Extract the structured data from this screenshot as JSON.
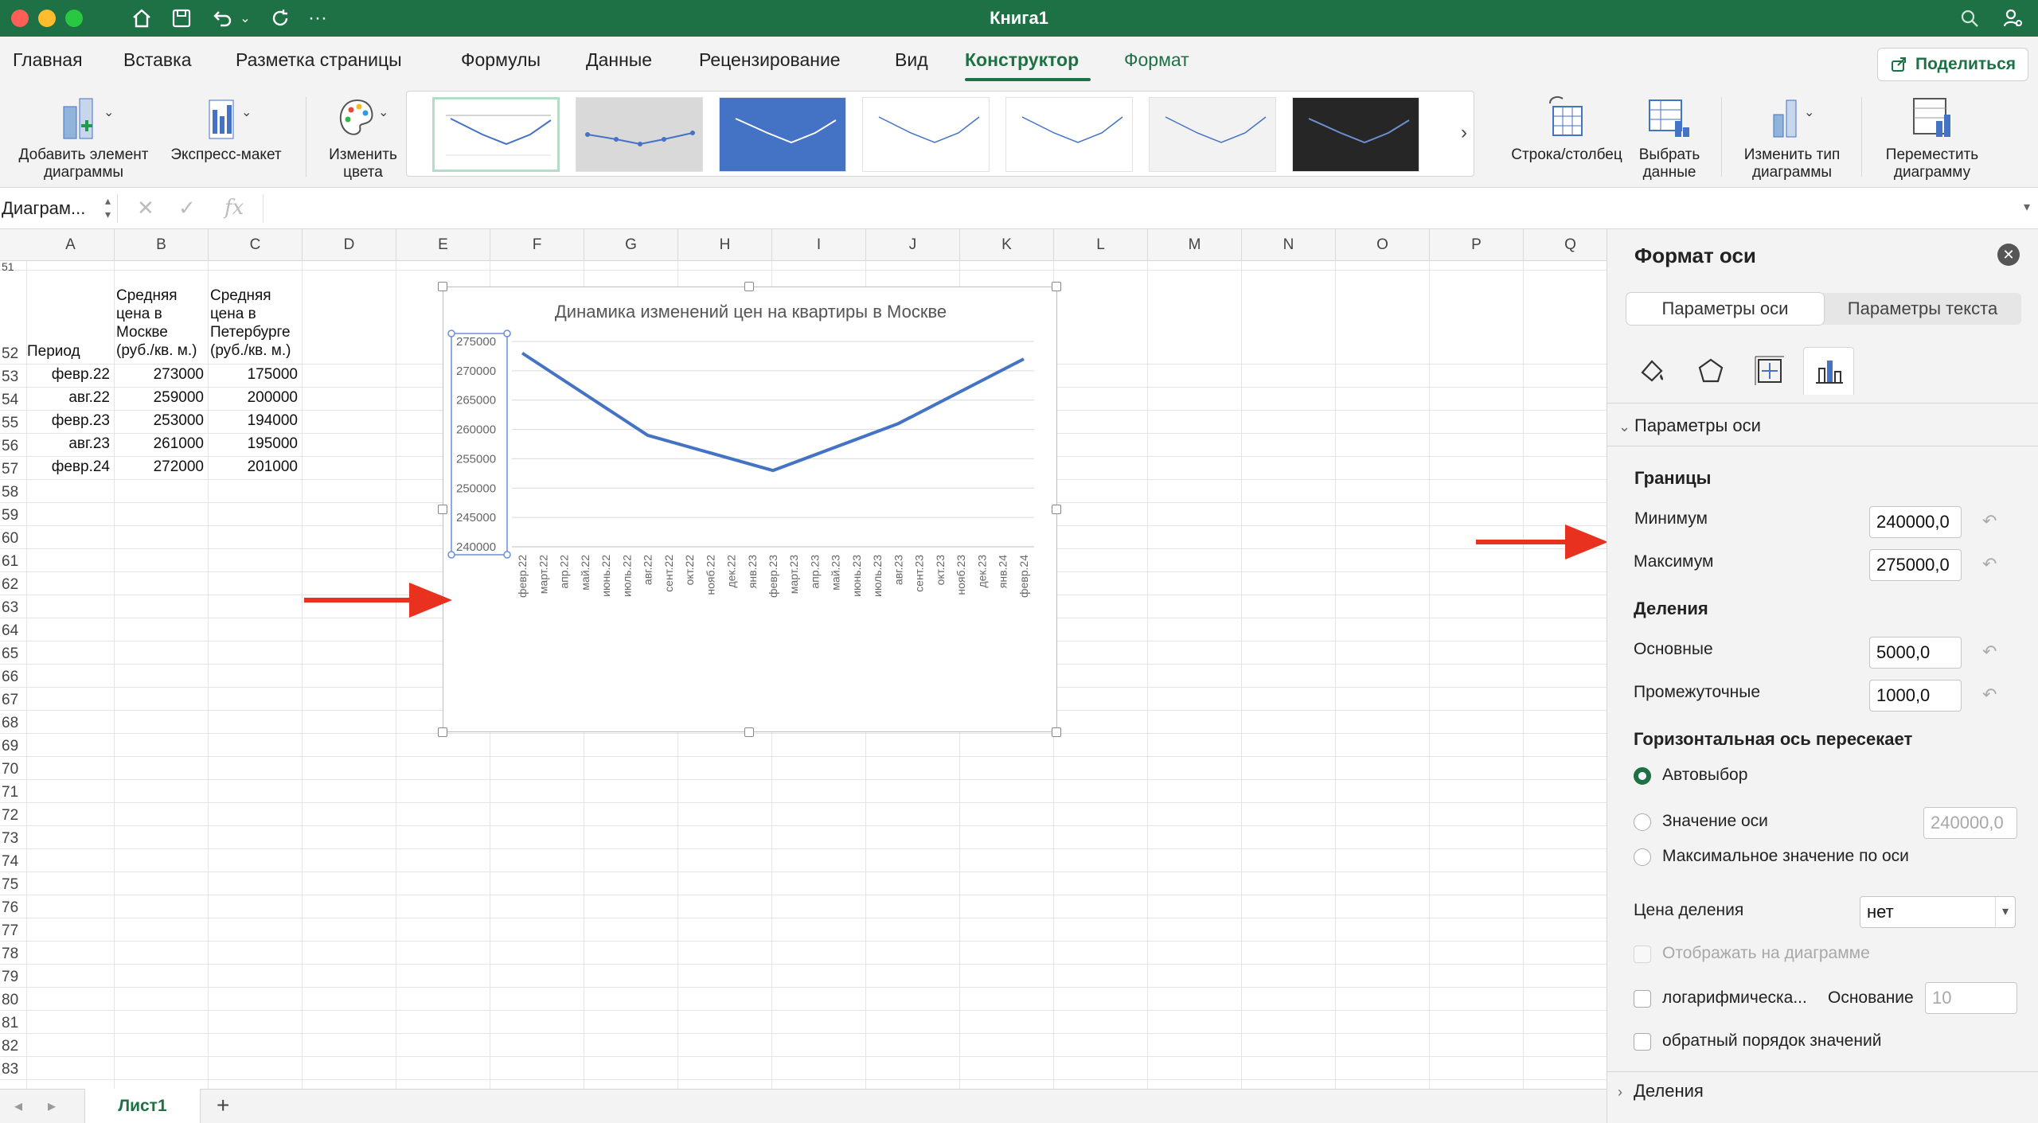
{
  "window": {
    "title": "Книга1"
  },
  "menu": {
    "tabs": [
      "Главная",
      "Вставка",
      "Разметка страницы",
      "Формулы",
      "Данные",
      "Рецензирование",
      "Вид",
      "Конструктор",
      "Формат"
    ],
    "active": "Конструктор",
    "share_label": "Поделиться"
  },
  "ribbon": {
    "add_element": "Добавить элемент диаграммы",
    "quick_layout": "Экспресс-макет",
    "change_colors": "Изменить цвета",
    "row_col": "Строка/столбец",
    "select_data": "Выбрать данные",
    "change_type": "Изменить тип диаграммы",
    "move_chart": "Переместить диаграмму"
  },
  "formula_bar": {
    "name_box": "Диаграм..."
  },
  "grid": {
    "columns": [
      "A",
      "B",
      "C",
      "D",
      "E",
      "F",
      "G",
      "H",
      "I",
      "J",
      "K",
      "L",
      "M",
      "N",
      "O",
      "P",
      "Q"
    ],
    "rows": [
      "51",
      "52",
      "53",
      "54",
      "55",
      "56",
      "57",
      "58",
      "59",
      "60",
      "61",
      "62",
      "63",
      "64",
      "65",
      "66",
      "67",
      "68",
      "69",
      "70",
      "71",
      "72",
      "73",
      "74",
      "75",
      "76",
      "77",
      "78",
      "79",
      "80",
      "81",
      "82",
      "83"
    ],
    "header_period": "Период",
    "header_moscow": [
      "Средняя",
      "цена в",
      "Москве",
      "(руб./кв. м.)"
    ],
    "header_spb": [
      "Средняя",
      "цена в",
      "Петербурге",
      "(руб./кв. м.)"
    ],
    "data": [
      {
        "period": "февр.22",
        "moscow": "273000",
        "spb": "175000"
      },
      {
        "period": "авг.22",
        "moscow": "259000",
        "spb": "200000"
      },
      {
        "period": "февр.23",
        "moscow": "253000",
        "spb": "194000"
      },
      {
        "period": "авг.23",
        "moscow": "261000",
        "spb": "195000"
      },
      {
        "period": "февр.24",
        "moscow": "272000",
        "spb": "201000"
      }
    ]
  },
  "chart_data": {
    "type": "line",
    "title": "Динамика изменений цен на квартиры в Москве",
    "x": [
      "февр.22",
      "март.22",
      "апр.22",
      "май.22",
      "июнь.22",
      "июль.22",
      "авг.22",
      "сент.22",
      "окт.22",
      "нояб.22",
      "дек.22",
      "янв.23",
      "февр.23",
      "март.23",
      "апр.23",
      "май.23",
      "июнь.23",
      "июль.23",
      "авг.23",
      "сент.23",
      "окт.23",
      "нояб.23",
      "дек.23",
      "янв.24",
      "февр.24"
    ],
    "points": [
      {
        "x": "февр.22",
        "y": 273000
      },
      {
        "x": "авг.22",
        "y": 259000
      },
      {
        "x": "февр.23",
        "y": 253000
      },
      {
        "x": "авг.23",
        "y": 261000
      },
      {
        "x": "февр.24",
        "y": 272000
      }
    ],
    "yticks": [
      "275000",
      "270000",
      "265000",
      "260000",
      "255000",
      "250000",
      "245000",
      "240000"
    ],
    "ylim": [
      240000,
      275000
    ],
    "grid": true,
    "line_color": "#4472c4"
  },
  "pane": {
    "title": "Формат оси",
    "tabs": [
      "Параметры оси",
      "Параметры текста"
    ],
    "section_axis": "Параметры оси",
    "bounds_h": "Границы",
    "min_label": "Минимум",
    "min_value": "240000,0",
    "max_label": "Максимум",
    "max_value": "275000,0",
    "units_h": "Деления",
    "major_label": "Основные",
    "major_value": "5000,0",
    "minor_label": "Промежуточные",
    "minor_value": "1000,0",
    "cross_h": "Горизонтальная ось пересекает",
    "auto_label": "Автовыбор",
    "axis_value_label": "Значение оси",
    "axis_value": "240000,0",
    "max_axis_label": "Максимальное значение по оси",
    "display_units_label": "Цена деления",
    "display_units_value": "нет",
    "show_on_chart": "Отображать на диаграмме",
    "log_label": "логарифмическа...",
    "base_label": "Основание",
    "base_value": "10",
    "reverse_label": "обратный порядок значений",
    "section_ticks": "Деления"
  },
  "sheets": {
    "active": "Лист1",
    "add": "+"
  },
  "colors": {
    "brand": "#1e7145",
    "arrow": "#e8321f"
  }
}
